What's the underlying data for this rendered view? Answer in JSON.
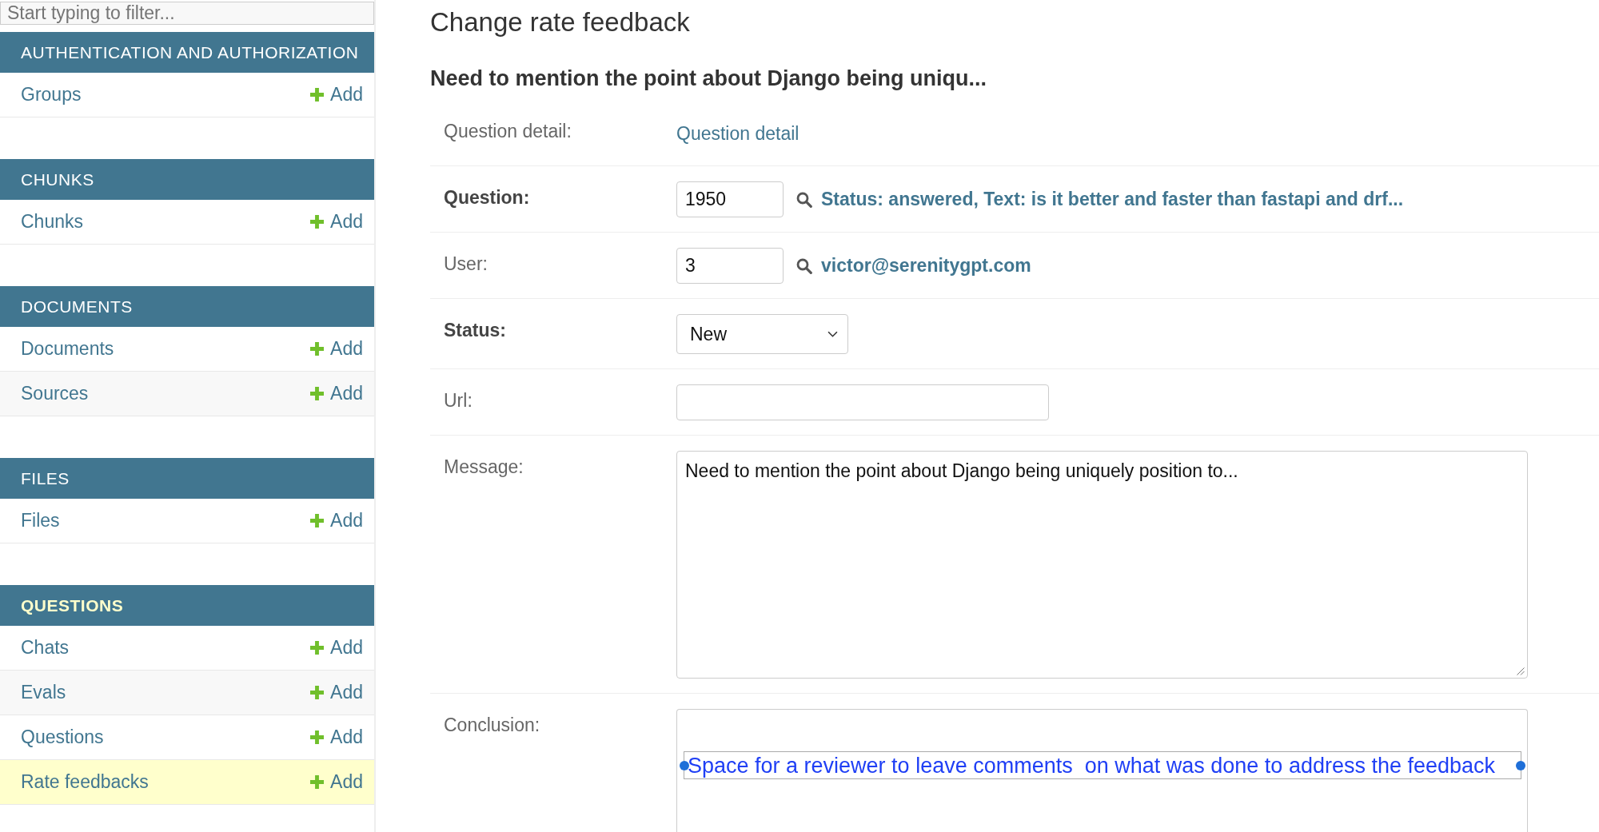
{
  "sidebar": {
    "filter": {
      "placeholder": "Start typing to filter..."
    },
    "sections": [
      {
        "title": "AUTHENTICATION AND AUTHORIZATION",
        "selected": false,
        "items": [
          {
            "name": "Groups",
            "add_link": "Add",
            "selected": false
          }
        ]
      },
      {
        "title": "CHUNKS",
        "selected": false,
        "items": [
          {
            "name": "Chunks",
            "add_link": "Add",
            "selected": false
          }
        ]
      },
      {
        "title": "DOCUMENTS",
        "selected": false,
        "items": [
          {
            "name": "Documents",
            "add_link": "Add",
            "selected": false
          },
          {
            "name": "Sources",
            "add_link": "Add",
            "selected": false
          }
        ]
      },
      {
        "title": "FILES",
        "selected": false,
        "items": [
          {
            "name": "Files",
            "add_link": "Add",
            "selected": false
          }
        ]
      },
      {
        "title": "QUESTIONS",
        "selected": true,
        "items": [
          {
            "name": "Chats",
            "add_link": "Add",
            "selected": false
          },
          {
            "name": "Evals",
            "add_link": "Add",
            "selected": false
          },
          {
            "name": "Questions",
            "add_link": "Add",
            "selected": false
          },
          {
            "name": "Rate feedbacks",
            "add_link": "Add",
            "selected": true
          }
        ]
      }
    ]
  },
  "main": {
    "title": "Change rate feedback",
    "subtitle": "Need to mention the point about Django being uniqu...",
    "fields": [
      {
        "kind": "link",
        "label": "Question detail:",
        "required": false,
        "link": "Question detail"
      },
      {
        "kind": "lookup",
        "label": "Question:",
        "required": true,
        "value": "1950",
        "link": "Status: answered, Text: is it better and faster than fastapi and drf..."
      },
      {
        "kind": "lookup",
        "label": "User:",
        "required": false,
        "value": "3",
        "link": "victor@serenitygpt.com"
      },
      {
        "kind": "select",
        "label": "Status:",
        "required": true,
        "value": "New"
      },
      {
        "kind": "text",
        "label": "Url:",
        "required": false
      },
      {
        "kind": "textarea",
        "label": "Message:",
        "required": false,
        "value": "Need to mention the point about Django being uniquely position to..."
      },
      {
        "kind": "textarea",
        "label": "Conclusion:",
        "required": false,
        "annotation": "Space for a reviewer to leave comments  on what was done to address the feedback"
      }
    ]
  }
}
